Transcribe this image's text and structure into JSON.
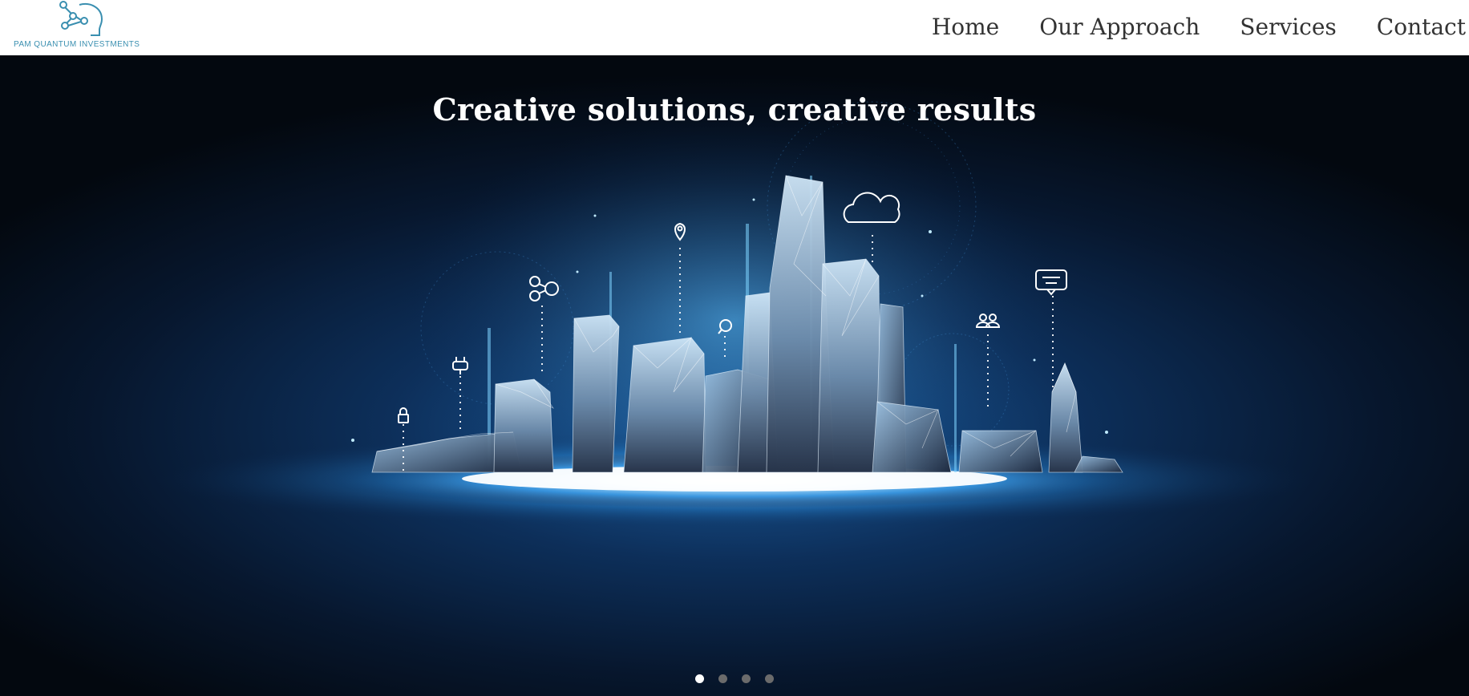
{
  "brand": {
    "name": "PAM QUANTUM INVESTMENTS",
    "logo_icon": "head-network-icon",
    "color": "#3a8fb0"
  },
  "nav": {
    "items": [
      {
        "label": "Home"
      },
      {
        "label": "Our Approach"
      },
      {
        "label": "Services"
      },
      {
        "label": "Contact"
      }
    ]
  },
  "hero": {
    "title": "Creative solutions, creative results",
    "background_color": "#07172e",
    "glow_color": "#4fb8ff",
    "icons": [
      "lock-icon",
      "plug-icon",
      "share-icon",
      "location-pin-icon",
      "chat-bubble-icon",
      "cloud-icon",
      "users-icon",
      "message-icon"
    ]
  },
  "carousel": {
    "slide_count": 4,
    "active_index": 0
  }
}
